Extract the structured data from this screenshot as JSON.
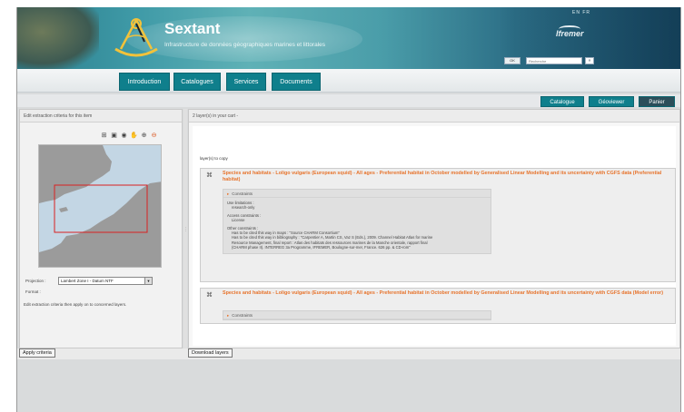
{
  "header": {
    "title": "Sextant",
    "subtitle": "Infrastructure de données géographiques marines et littorales",
    "lang": "EN  FR",
    "brand": "Ifremer",
    "search_button": "OK",
    "search_placeholder": "Recherche",
    "search_go": "»"
  },
  "nav": {
    "items": [
      "Introduction",
      "Catalogues",
      "Services",
      "Documents"
    ]
  },
  "tabs": {
    "items": [
      "Catalogue",
      "Géoviewer",
      "Panier"
    ]
  },
  "left_panel": {
    "header": "Edit extraction criteria for this item",
    "projection_label": "Projection :",
    "projection_value": "Lambert Zone I - Datum NTF",
    "format_label": "Format :",
    "note": "Edit extraction criteria then apply on to concerned layers.",
    "apply_button": "Apply criteria"
  },
  "right_panel": {
    "header": "2 layer(s) in your cart -",
    "layers_label": "layer(s) to copy",
    "download_button": "Download layers",
    "layers": [
      {
        "title": "Species and habitats - Loligo vulgaris (European squid) - All ages - Preferential habitat in October modelled by Generalised Linear Modelling and its uncertainty with CGFS data (Preferential habitat)",
        "constraints_label": "Constraints",
        "use_limitations_label": "Use limitations :",
        "use_limitations_value": "research-only",
        "access_label": "Access constraints :",
        "access_value": "License",
        "other_label": "Other constraints :",
        "other_line1": "Has to be cited this way in maps : \"Source CHARM Consortium\"",
        "other_line2": "Has to be cited this way in bibliography : \"Carpentier A, Martin CS, Vaz S (Eds.), 2009. Channel Habitat Atlas for marine",
        "other_line3": "Resource Management, final report : Atlas des habitats des ressources marines de la Manche orientale, rapport final",
        "other_line4": "(CHARM phase II). INTERREG 3a Programme, IFREMER, Boulogne-sur-mer, France. 626 pp. & CD-rom\""
      },
      {
        "title": "Species and habitats - Loligo vulgaris (European squid) - All ages - Preferential habitat in October modelled by Generalised Linear Modelling and its uncertainty with CGFS data (Model error)",
        "constraints_label": "Constraints"
      }
    ]
  }
}
